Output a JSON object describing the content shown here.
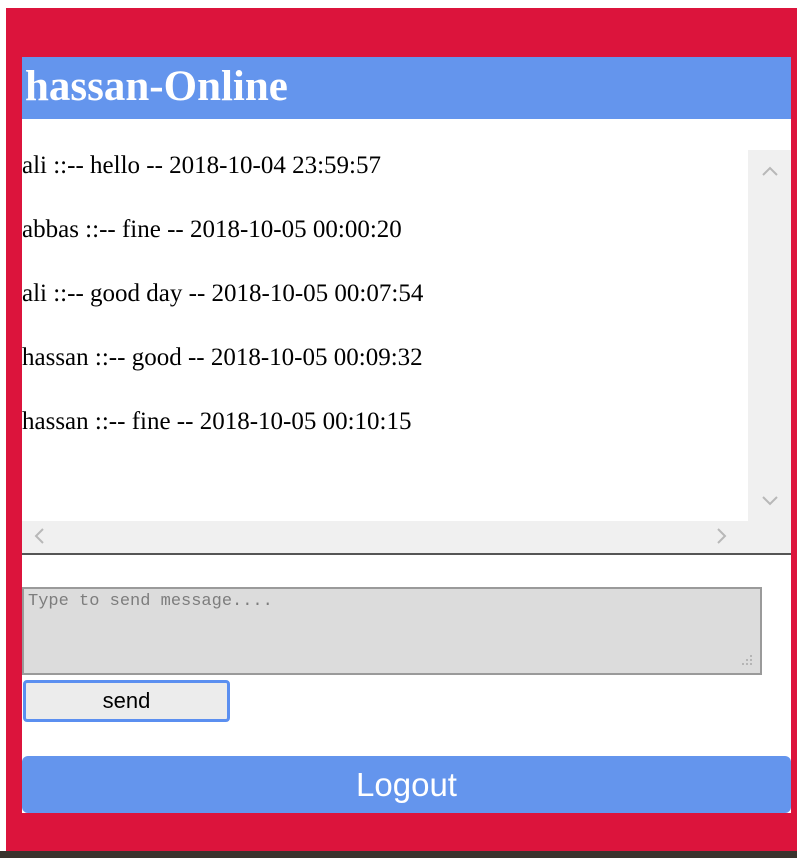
{
  "header": {
    "title": "hassan-Online"
  },
  "chat": {
    "messages": [
      "ali ::-- hello -- 2018-10-04 23:59:57",
      "abbas ::-- fine -- 2018-10-05 00:00:20",
      "ali ::-- good day -- 2018-10-05 00:07:54",
      "hassan ::-- good -- 2018-10-05 00:09:32",
      "hassan ::-- fine -- 2018-10-05 00:10:15"
    ],
    "scroll_up_icon": "chevron-up-icon",
    "scroll_down_icon": "chevron-down-icon",
    "scroll_left_icon": "chevron-left-icon",
    "scroll_right_icon": "chevron-right-icon"
  },
  "composer": {
    "placeholder": "Type to send message....",
    "value": "",
    "send_label": "send"
  },
  "logout": {
    "label": "Logout"
  },
  "colors": {
    "background": "#dc143c",
    "accent": "#6495ed",
    "input_bg": "#dcdcdc"
  }
}
